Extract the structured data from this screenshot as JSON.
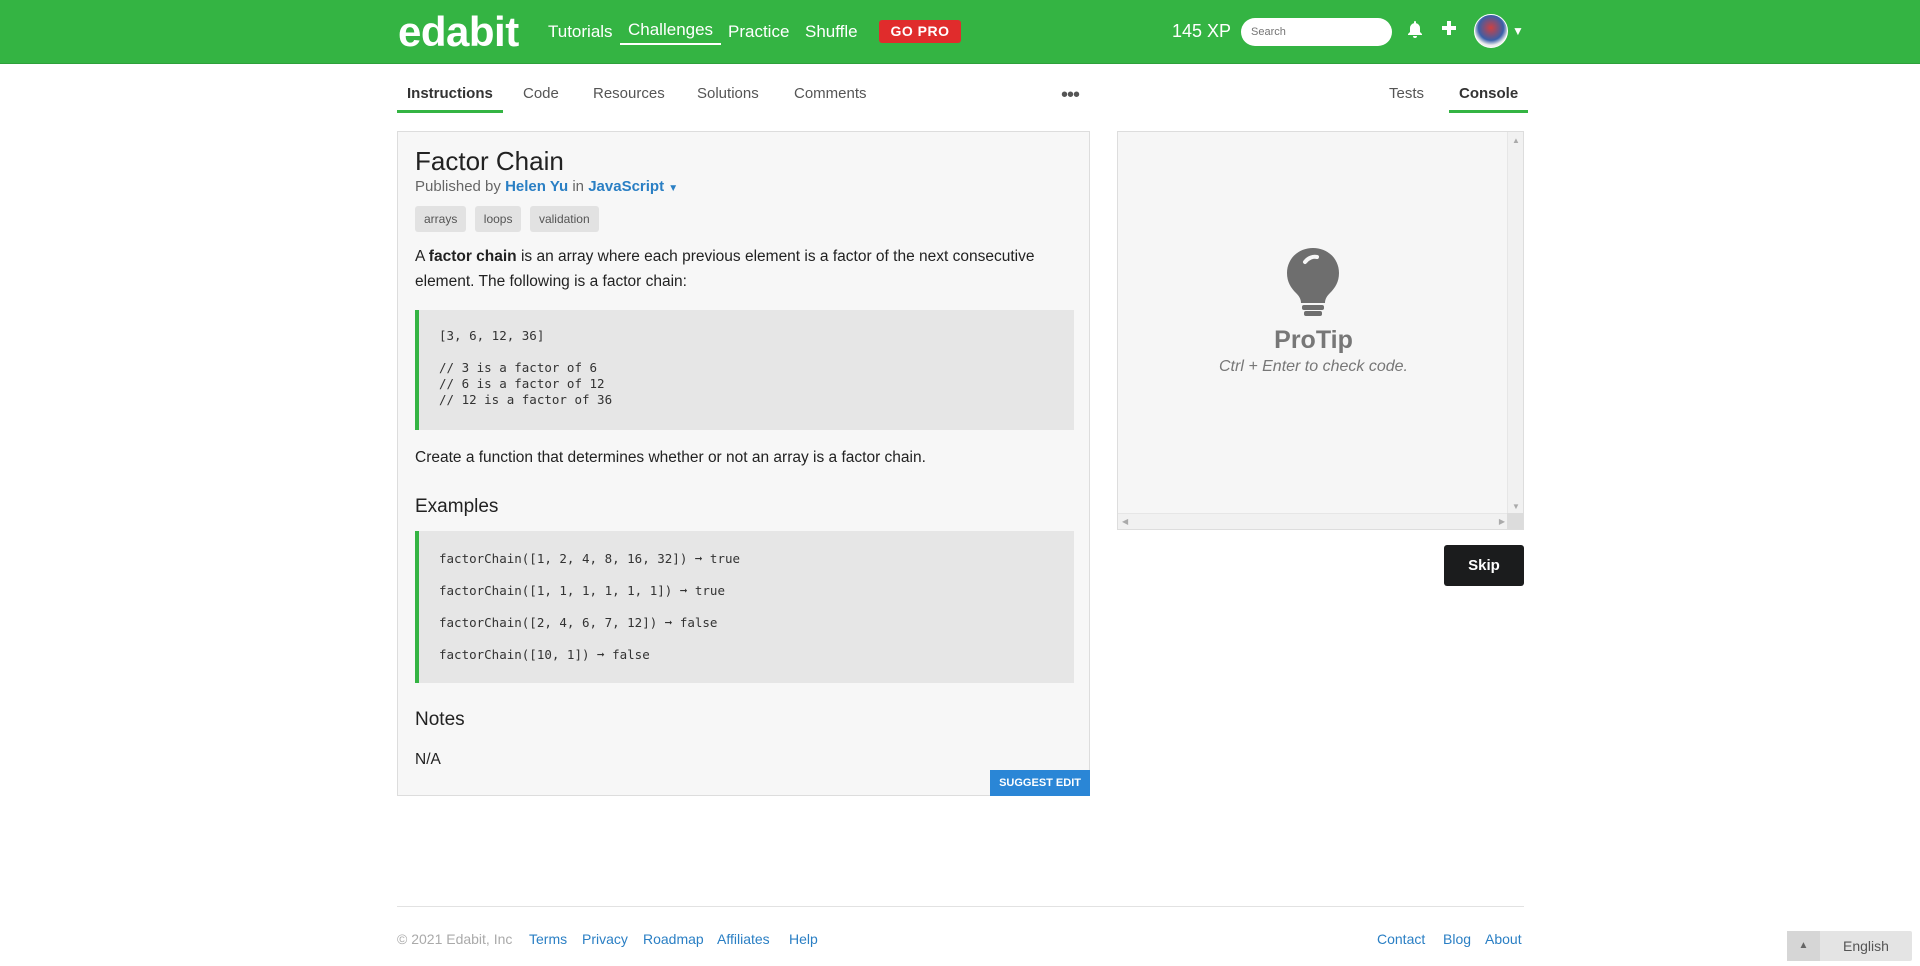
{
  "topbar": {
    "brand": "edabit",
    "nav": [
      "Tutorials",
      "Challenges",
      "Practice",
      "Shuffle"
    ],
    "gopro": "GO PRO",
    "xp": "145 XP",
    "search_placeholder": "Search",
    "accent": "#34b443",
    "gopro_color": "#e02c2c"
  },
  "tabs": {
    "instructions": "Instructions",
    "code": "Code",
    "resources": "Resources",
    "solutions": "Solutions",
    "comments": "Comments",
    "more": "•••",
    "tests": "Tests",
    "console": "Console"
  },
  "challenge": {
    "title": "Factor Chain",
    "published_by": "Published by",
    "author": "Helen Yu",
    "in": "in",
    "language": "JavaScript",
    "tags": [
      "arrays",
      "loops",
      "validation"
    ],
    "intro_pre": "A",
    "intro_bold": "factor chain",
    "intro_post": "is an array where each previous element is a factor of the next consecutive element. The following is a factor chain:",
    "chain_code": [
      "[3, 6, 12, 36]",
      "// 3 is a factor of 6",
      "// 6 is a factor of 12",
      "// 12 is a factor of 36"
    ],
    "task": "Create a function that determines whether or not an array is a factor chain.",
    "examples_heading": "Examples",
    "examples": [
      "factorChain([1, 2, 4, 8, 16, 32]) ➞ true",
      "factorChain([1, 1, 1, 1, 1, 1]) ➞ true",
      "factorChain([2, 4, 6, 7, 12]) ➞ false",
      "factorChain([10, 1]) ➞ false"
    ],
    "notes_heading": "Notes",
    "notes": "N/A",
    "suggest_edit": "SUGGEST EDIT"
  },
  "console": {
    "protip_title": "ProTip",
    "protip_text": "Ctrl + Enter to check code.",
    "skip": "Skip"
  },
  "footer": {
    "copyright": "© 2021 Edabit, Inc",
    "left_links": [
      "Terms",
      "Privacy",
      "Roadmap",
      "Affiliates",
      "Help"
    ],
    "right_links": [
      "Contact",
      "Blog",
      "About"
    ],
    "language": "English"
  }
}
